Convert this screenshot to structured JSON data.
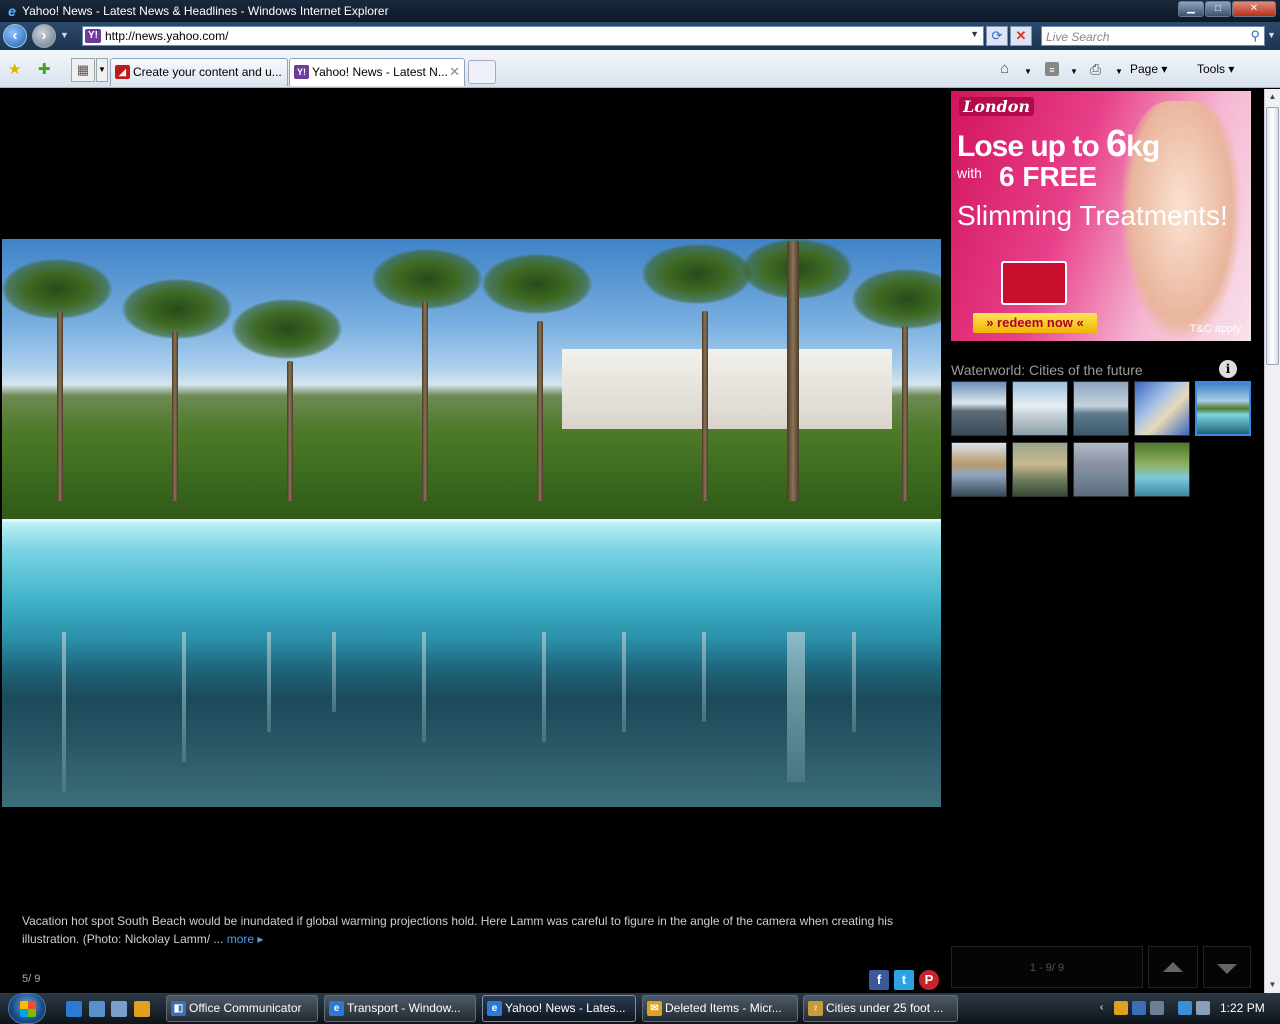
{
  "window": {
    "title": "Yahoo! News - Latest News & Headlines - Windows Internet Explorer",
    "minimize": "▁",
    "maximize": "□",
    "close": "✕"
  },
  "addressbar": {
    "url": "http://news.yahoo.com/",
    "search_placeholder": "Live Search"
  },
  "tabs": [
    {
      "label": "Create your content and u..."
    },
    {
      "label": "Yahoo! News - Latest N..."
    }
  ],
  "commandbar": {
    "page_label": "Page ▾",
    "tools_label": "Tools ▾"
  },
  "slideshow": {
    "caption": "Vacation hot spot South Beach would be inundated if global warming projections hold. Here Lamm was careful to figure in the angle of the camera when creating his illustration. (Photo: Nickolay Lamm/ ...",
    "more_link": "more ▸",
    "counter": "5/ 9"
  },
  "ad": {
    "brand": "London",
    "line1_prefix": "Lose up to ",
    "line1_num": "6",
    "line1_suffix": "kg",
    "with": "with",
    "free": "6 FREE",
    "treatments": "Slimming Treatments!",
    "cta": "» redeem now «",
    "tc": "T&C apply"
  },
  "gallery": {
    "title": "Waterworld: Cities of the future",
    "range": "1 - 9/ 9",
    "active_index": 5,
    "thumb_count": 9
  },
  "taskbar": {
    "items": [
      {
        "label": "Office Communicator"
      },
      {
        "label": "Transport - Window..."
      },
      {
        "label": "Yahoo! News - Lates..."
      },
      {
        "label": "Deleted Items - Micr..."
      },
      {
        "label": "Cities under 25 foot ..."
      }
    ],
    "clock": "1:22 PM"
  },
  "colors": {
    "accent_link": "#4a9de8",
    "active_thumb_border": "#3a8be0",
    "ad_pink": "#d3135e"
  }
}
